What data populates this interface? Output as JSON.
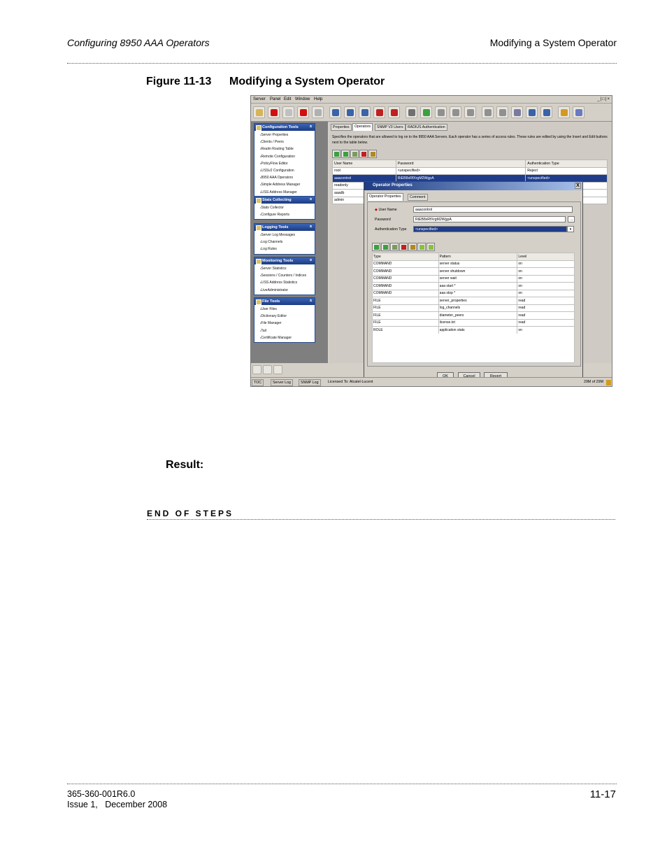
{
  "header": {
    "left": "Configuring 8950 AAA Operators",
    "right": "Modifying a System Operator"
  },
  "figure": {
    "number": "Figure 11-13",
    "title": "Modifying a System Operator"
  },
  "screenshot": {
    "menu": [
      "Server",
      "Panel",
      "Edit",
      "Window",
      "Help"
    ],
    "window_controls": "_|□|×",
    "toolbar_colors": [
      "#d7b35a",
      "#d01010",
      "#c0c0c0",
      "#d01010",
      "#b0b0b0",
      "#3a63a8",
      "#3a63a8",
      "#3a63a8",
      "#c02020",
      "#c02020",
      "#707070",
      "#3aa040",
      "#909090",
      "#909090",
      "#909090",
      "#909090",
      "#909090",
      "#7a7aa0",
      "#3a63a8",
      "#3a63a8",
      "#d49a20",
      "#6a7ac0"
    ],
    "left_groups": [
      {
        "title": "Configuration Tools",
        "items": [
          "Server Properties",
          "Clients / Peers",
          "Realm Routing Table",
          "Remote Configuration",
          "PolicyFlow Editor",
          "LISSv2 Configuration",
          "8950 AAA Operators",
          "Simple Address Manager",
          "LISS Address Manager"
        ]
      },
      {
        "title": "Stats Collecting",
        "items": [
          "Stats Collector",
          "Configure Reports"
        ]
      },
      {
        "title": "Logging Tools",
        "items": [
          "Server Log Messages",
          "Log Channels",
          "Log Rules"
        ]
      },
      {
        "title": "Monitoring Tools",
        "items": [
          "Server Statistics",
          "Sessions / Counters / Indices",
          "LISS Address Statistics",
          "LiveAdministrator"
        ]
      },
      {
        "title": "File Tools",
        "items": [
          "User Files",
          "Dictionary Editor",
          "File Manager",
          "Tail",
          "Certificate Manager"
        ]
      }
    ],
    "tabs": [
      "Properties",
      "Operators",
      "SNMP V3 Users",
      "RADIUS Authentication"
    ],
    "active_tab": "Operators",
    "description": "Specifies the operators that are allowed to log on to the 8950 AAA Servers. Each operator has a series of access rules. These rules are edited by using the Insert and Edit buttons next to the table below.",
    "operators_table": {
      "columns": [
        "User Name",
        "Password",
        "Authentication Type"
      ],
      "rows": [
        [
          "root",
          "<unspecified>",
          "Reject"
        ],
        [
          "aaacontrol",
          "RiEB8xRfXrgM2WgpA",
          "<unspecified>"
        ],
        [
          "readonly",
          "",
          ""
        ],
        [
          "aaadb",
          "",
          ""
        ],
        [
          "admin",
          "",
          ""
        ]
      ]
    },
    "dialog": {
      "title": "Operator Properties",
      "close": "X",
      "tabs": [
        "Operator Properties",
        "Comment"
      ],
      "username_label": "User Name",
      "username_value": "aaacontrol",
      "password_label": "Password",
      "password_value": "RiEB8xRfXrgM2WgpA",
      "browse_label": "...",
      "auth_label": "Authentication Type",
      "auth_value": "<unspecified>",
      "auth_arrow": "▾",
      "rules": {
        "columns": [
          "Type",
          "Pattern",
          "Level"
        ],
        "rows": [
          [
            "COMMAND",
            "server status",
            "on"
          ],
          [
            "COMMAND",
            "server shutdown",
            "on"
          ],
          [
            "COMMAND",
            "server wait",
            "on"
          ],
          [
            "COMMAND",
            "aaa start *",
            "on"
          ],
          [
            "COMMAND",
            "aaa stop *",
            "on"
          ],
          [
            "FILE",
            "server_properties",
            "read"
          ],
          [
            "FILE",
            "log_channels",
            "read"
          ],
          [
            "FILE",
            "diameter_peers",
            "read"
          ],
          [
            "FILE",
            "license.txt",
            "read"
          ],
          [
            "ROLE",
            "application stats",
            "on"
          ]
        ]
      },
      "buttons": {
        "ok": "OK",
        "cancel": "Cancel",
        "revert": "Revert"
      }
    },
    "status": {
      "toc": "TOC",
      "server_log": "Server Log",
      "snmp_log": "SNMP Log",
      "licensed": "Licensed To: Alcatel-Lucent",
      "memory": "29M of 29M"
    }
  },
  "result_label": "Result:",
  "end_of_steps": "End of Steps",
  "footer": {
    "doc_number": "365-360-001R6.0",
    "issue": "Issue 1,   December 2008",
    "page": "11-17"
  }
}
